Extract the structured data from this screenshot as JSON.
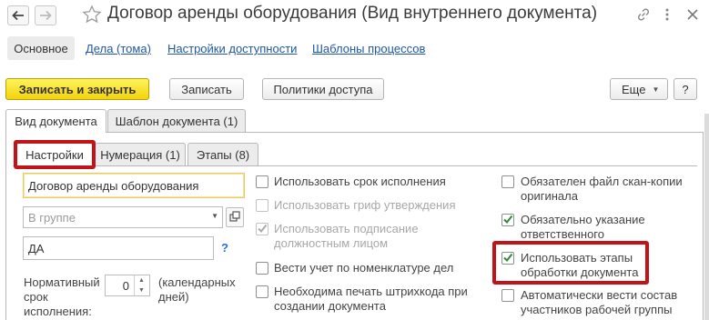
{
  "window": {
    "title": "Договор аренды оборудования (Вид внутреннего документа)",
    "icons": [
      "arrow-left-icon",
      "arrow-right-icon",
      "star-icon",
      "link-icon",
      "more-icon",
      "close-icon"
    ]
  },
  "sections": {
    "items": [
      {
        "label": "Основное",
        "active": true
      },
      {
        "label": "Дела (тома)"
      },
      {
        "label": "Настройки доступности"
      },
      {
        "label": "Шаблоны процессов"
      }
    ]
  },
  "toolbar": {
    "save_close_label": "Записать и закрыть",
    "save_label": "Записать",
    "access_policies_label": "Политики доступа",
    "more_label": "Еще",
    "help_label": "?"
  },
  "tabs": {
    "outer": [
      "Вид документа",
      "Шаблон документа (1)"
    ],
    "inner": [
      "Настройки",
      "Нумерация (1)",
      "Этапы (8)"
    ]
  },
  "settings": {
    "name_value": "Договор аренды оборудования",
    "group_placeholder": "В группе",
    "code_value": "ДА",
    "help_mark": "?",
    "term_label": "Нормативный срок исполнения:",
    "term_value": "0",
    "term_unit": "(календарных дней)"
  },
  "checkboxes_middle": [
    {
      "label": "Использовать срок исполнения",
      "checked": false,
      "disabled": false
    },
    {
      "label": "Использовать гриф утверждения",
      "checked": false,
      "disabled": true
    },
    {
      "label": "Использовать подписание должностным лицом",
      "checked": true,
      "disabled": true
    },
    {
      "label": "Вести учет по номенклатуре дел",
      "checked": false,
      "disabled": false
    },
    {
      "label": "Необходима печать штрихкода при создании документа",
      "checked": false,
      "disabled": false
    }
  ],
  "checkboxes_right": [
    {
      "label": "Обязателен файл скан-копии оригинала",
      "checked": false
    },
    {
      "label": "Обязательно указание ответственного",
      "checked": true
    },
    {
      "label": "Использовать этапы обработки документа",
      "checked": true
    },
    {
      "label": "Автоматически вести состав участников рабочей группы",
      "checked": false
    }
  ],
  "colors": {
    "primary_button": "#f3d40a",
    "highlight_frame": "#c0141a",
    "link": "#1f57a4",
    "check": "#2e8a35"
  }
}
